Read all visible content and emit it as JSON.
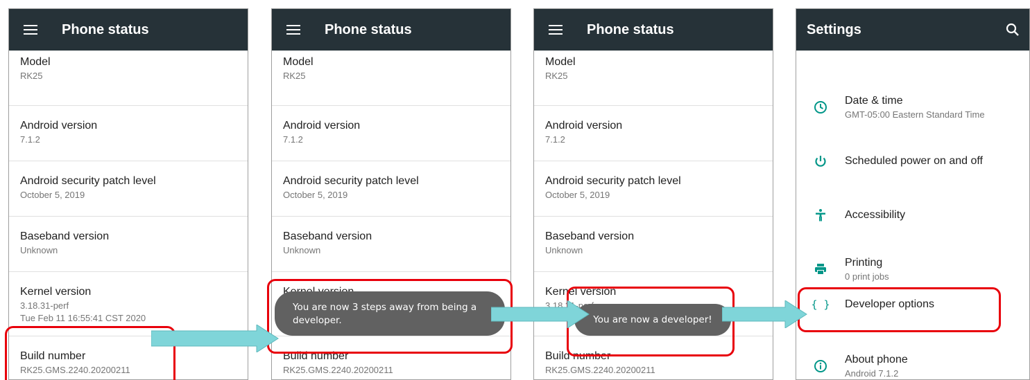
{
  "phone_status": {
    "title": "Phone status",
    "rows": [
      {
        "title": "Model",
        "value": "RK25"
      },
      {
        "title": "Android version",
        "value": "7.1.2"
      },
      {
        "title": "Android security patch level",
        "value": "October 5, 2019"
      },
      {
        "title": "Baseband version",
        "value": "Unknown"
      },
      {
        "title": "Kernel version",
        "value": "3.18.31-perf",
        "value2": "Tue Feb 11 16:55:41 CST 2020"
      },
      {
        "title": "Build number",
        "value": "RK25.GMS.2240.20200211"
      }
    ]
  },
  "toasts": {
    "three_steps": "You are now 3 steps away from being a developer.",
    "developer": "You are now a developer!"
  },
  "settings": {
    "title": "Settings",
    "items": [
      {
        "title": "Date & time",
        "subtitle": "GMT-05:00 Eastern Standard Time",
        "icon": "clock-icon"
      },
      {
        "title": "Scheduled power on and off",
        "subtitle": "",
        "icon": "power-icon"
      },
      {
        "title": "Accessibility",
        "subtitle": "",
        "icon": "accessibility-icon"
      },
      {
        "title": "Printing",
        "subtitle": "0 print jobs",
        "icon": "printer-icon"
      },
      {
        "title": "Developer options",
        "subtitle": "",
        "icon": "code-braces-icon"
      },
      {
        "title": "About phone",
        "subtitle": "Android 7.1.2",
        "icon": "info-icon"
      }
    ]
  },
  "colors": {
    "appbar": "#263238",
    "accent": "#009688",
    "highlight": "#e8000b",
    "arrow": "#7fd5d9",
    "toast": "#616161"
  }
}
